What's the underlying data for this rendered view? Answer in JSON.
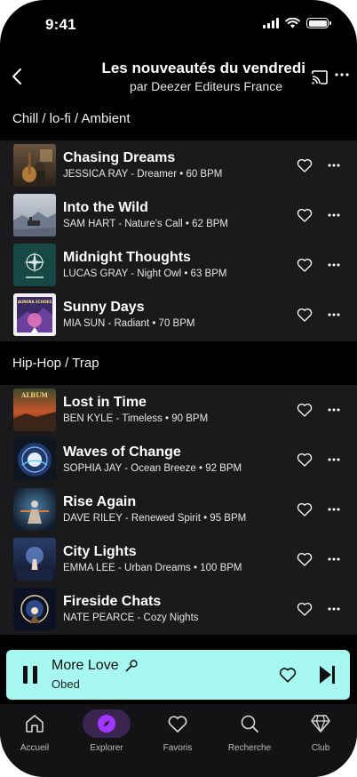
{
  "status_bar": {
    "time": "9:41"
  },
  "header": {
    "title": "Les nouveautés du vendredi",
    "subtitle": "par Deezer Editeurs France"
  },
  "sections": [
    {
      "title": "Chill / lo-fi / Ambient",
      "tracks": [
        {
          "title": "Chasing Dreams",
          "meta": "JESSICA RAY - Dreamer • 60 BPM"
        },
        {
          "title": "Into the Wild",
          "meta": "SAM HART - Nature's Call • 62 BPM"
        },
        {
          "title": "Midnight Thoughts",
          "meta": "LUCAS GRAY - Night Owl • 63 BPM"
        },
        {
          "title": "Sunny Days",
          "meta": "MIA SUN - Radiant • 70 BPM"
        }
      ]
    },
    {
      "title": "Hip-Hop / Trap",
      "tracks": [
        {
          "title": "Lost in Time",
          "meta": "BEN KYLE - Timeless • 90 BPM"
        },
        {
          "title": "Waves of Change",
          "meta": "SOPHIA JAY - Ocean Breeze • 92 BPM"
        },
        {
          "title": "Rise Again",
          "meta": "DAVE RILEY - Renewed Spirit • 95 BPM"
        },
        {
          "title": "City Lights",
          "meta": "EMMA LEE - Urban Dreams • 100 BPM"
        },
        {
          "title": "Fireside Chats",
          "meta": "NATE PEARCE - Cozy Nights"
        }
      ]
    }
  ],
  "covers": {
    "album_label": "ALBUM",
    "aurora_label": "AURORA ECHOES"
  },
  "player": {
    "title": "More Love",
    "artist": "Obed",
    "background": "#a6f7ef"
  },
  "tabs": [
    {
      "label": "Accueil",
      "icon": "home-icon",
      "active": false
    },
    {
      "label": "Explorer",
      "icon": "compass-icon",
      "active": true
    },
    {
      "label": "Favoris",
      "icon": "heart-icon",
      "active": false
    },
    {
      "label": "Recherche",
      "icon": "search-icon",
      "active": false
    },
    {
      "label": "Club",
      "icon": "diamond-icon",
      "active": false
    }
  ],
  "colors": {
    "accent": "#a238ff",
    "row_background": "#1a1a1d",
    "player_background": "#a6f7ef"
  }
}
